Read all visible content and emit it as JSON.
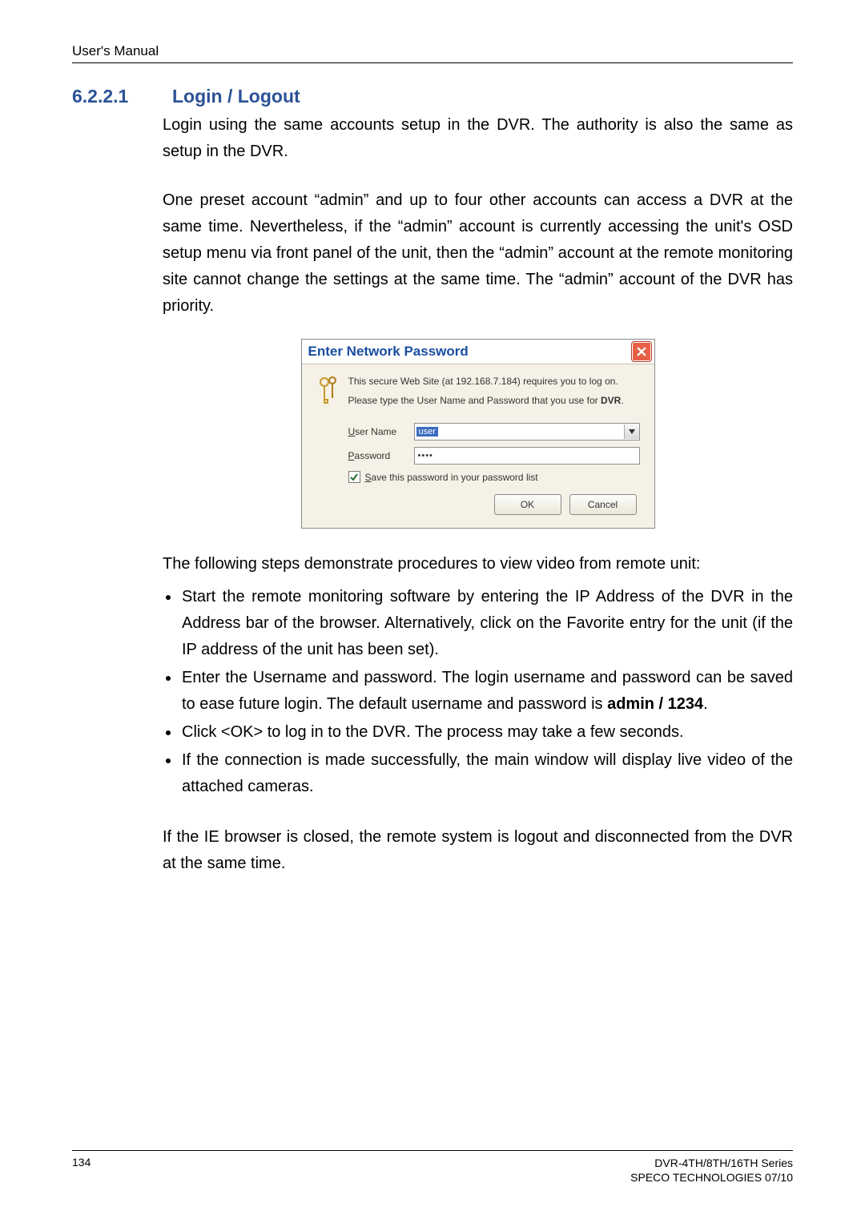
{
  "header": "User's Manual",
  "section": {
    "number": "6.2.2.1",
    "title": "Login / Logout"
  },
  "para1": "Login using the same accounts setup in the DVR. The authority is also the same as setup in the DVR.",
  "para2": "One preset account “admin” and up to four other accounts can access a DVR at the same time. Nevertheless, if the “admin” account is currently accessing the unit's OSD setup menu via front panel of the unit, then the “admin” account at the remote monitoring site cannot change the settings at the same time. The “admin” account of the DVR has priority.",
  "dialog": {
    "title": "Enter Network Password",
    "line1": "This secure Web Site (at 192.168.7.184) requires you to log on.",
    "line2_pre": "Please type the User Name and Password that you use for ",
    "line2_bold": "DVR",
    "line2_post": ".",
    "user_label_u": "U",
    "user_label_rest": "ser Name",
    "user_value": "user",
    "pass_label_u": "P",
    "pass_label_rest": "assword",
    "pass_value": "••••",
    "save_u": "S",
    "save_rest": "ave this password in your password list",
    "ok": "OK",
    "cancel": "Cancel"
  },
  "para3": "The following steps demonstrate procedures to view video from remote unit:",
  "steps": {
    "s1": "Start the remote monitoring software by entering the IP Address of the DVR in the Address bar of the browser. Alternatively, click on the Favorite entry for the unit (if the IP address of the unit has been set).",
    "s2_pre": "Enter the Username and password. The login username and password can be saved to ease future login. The default username and password is ",
    "s2_bold": "admin / 1234",
    "s2_post": ".",
    "s3": "Click <OK> to log in to the DVR. The process may take a few seconds.",
    "s4": "If the connection is made successfully, the main window will display live video of the attached cameras."
  },
  "para4": "If the IE browser is closed, the remote system is logout and disconnected from the DVR at the same time.",
  "footer": {
    "page": "134",
    "line1": "DVR-4TH/8TH/16TH Series",
    "line2": "SPECO TECHNOLOGIES 07/10"
  }
}
